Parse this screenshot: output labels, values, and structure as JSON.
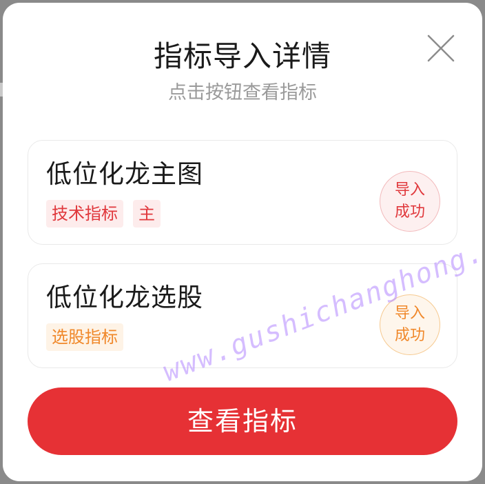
{
  "dialog": {
    "title": "指标导入详情",
    "subtitle": "点击按钮查看指标",
    "close_icon": "close-icon"
  },
  "indicators": [
    {
      "name": "低位化龙主图",
      "tags": [
        "技术指标",
        "主"
      ],
      "status_line1": "导入",
      "status_line2": "成功",
      "accent": "#e0383c"
    },
    {
      "name": "低位化龙选股",
      "tags": [
        "选股指标"
      ],
      "status_line1": "导入",
      "status_line2": "成功",
      "accent": "#f0882a"
    }
  ],
  "actions": {
    "view_label": "查看指标"
  },
  "watermark": "www.gushichanghong.com",
  "colors": {
    "primary": "#e63135",
    "overlay": "#8a8a8a"
  }
}
